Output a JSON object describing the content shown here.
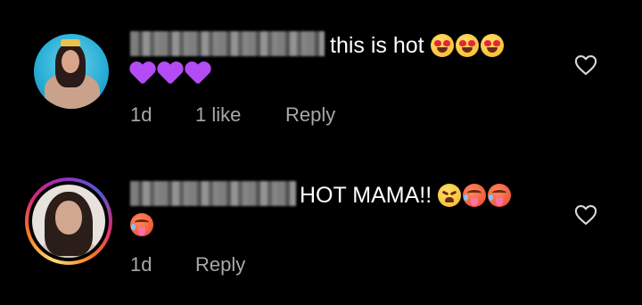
{
  "comments": [
    {
      "text": "this is hot",
      "emoji_inline": [
        "heart-eyes",
        "heart-eyes",
        "heart-eyes"
      ],
      "emoji_line2": [
        "purple-heart",
        "purple-heart",
        "purple-heart"
      ],
      "time": "1d",
      "likes": "1 like",
      "reply_label": "Reply"
    },
    {
      "text": "HOT MAMA!!",
      "emoji_inline": [
        "tired-face",
        "hot-face",
        "hot-face"
      ],
      "emoji_line2": [
        "hot-face"
      ],
      "time": "1d",
      "reply_label": "Reply",
      "has_story_ring": true
    }
  ],
  "colors": {
    "background": "#000000",
    "text": "#ffffff",
    "meta": "#a8a8a8",
    "purple_heart": "#b44cf5",
    "story_ring": [
      "#feda75",
      "#fa7e1e",
      "#d62976",
      "#962fbf",
      "#4f5bd5"
    ]
  },
  "icons": {
    "like": "heart-outline-icon"
  }
}
